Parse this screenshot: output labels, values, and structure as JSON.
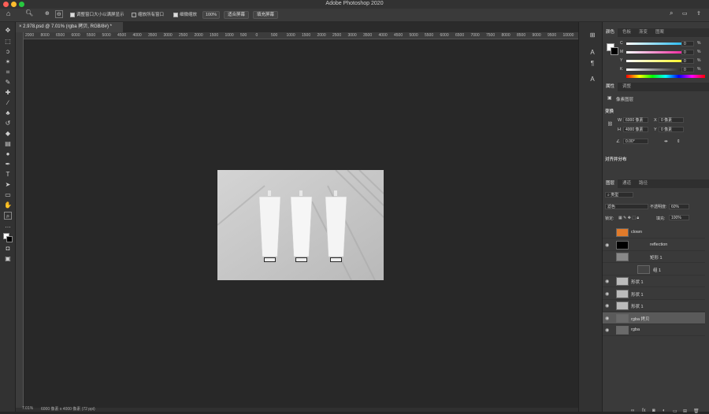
{
  "app": {
    "title": "Adobe Photoshop 2020"
  },
  "options_bar": {
    "checkbox_resize_window": "调整窗口大小以满屏显示",
    "checkbox_zoom_all": "缩放所有窗口",
    "checkbox_scrubby_zoom": "细微缩放",
    "zoom_value": "100%",
    "fit_screen": "适合屏幕",
    "fill_screen": "填充屏幕"
  },
  "document_tab": {
    "label": "2.978.psd @ 7.01% (rgba 拷贝, RGB/8#) *"
  },
  "ruler": {
    "ticks": [
      "2000",
      "8000",
      "6500",
      "6000",
      "5500",
      "5000",
      "4500",
      "4000",
      "3500",
      "3000",
      "2500",
      "2000",
      "1500",
      "1000",
      "500",
      "0",
      "500",
      "1000",
      "1500",
      "2000",
      "2500",
      "3000",
      "3500",
      "4000",
      "4500",
      "5000",
      "5500",
      "6000",
      "6500",
      "7000",
      "7500",
      "8000",
      "8500",
      "9000",
      "9500",
      "10000"
    ]
  },
  "status_bar": {
    "zoom": "7.01%",
    "info": "6000 像素 x 4000 像素 (72 ppi)"
  },
  "color_panel": {
    "tabs": [
      "颜色",
      "色板",
      "渐变",
      "图案"
    ],
    "channels": [
      {
        "label": "C",
        "value": "0",
        "unit": "%",
        "color": "#00aeef"
      },
      {
        "label": "M",
        "value": "0",
        "unit": "%",
        "color": "#ec008c"
      },
      {
        "label": "Y",
        "value": "0",
        "unit": "%",
        "color": "#fff200"
      },
      {
        "label": "K",
        "value": "0",
        "unit": "%",
        "color": "#000000"
      }
    ]
  },
  "properties_panel": {
    "tabs": [
      "属性",
      "调整"
    ],
    "type_label": "像素图层",
    "transform_title": "变换",
    "w_label": "W",
    "w_value": "6000 像素",
    "x_label": "X",
    "x_value": "0 像素",
    "h_label": "H",
    "h_value": "4000 像素",
    "y_label": "Y",
    "y_value": "0 像素",
    "angle_value": "0.00°",
    "align_title": "对齐并分布"
  },
  "layers_panel": {
    "tabs": [
      "图层",
      "通道",
      "路径"
    ],
    "filter_label": "类型",
    "blend_mode": "滤色",
    "opacity_label": "不透明度:",
    "opacity_value": "60%",
    "lock_label": "锁定:",
    "fill_label": "填充:",
    "fill_value": "100%",
    "layers": [
      {
        "name": "clown",
        "visible": false,
        "selected": false,
        "thumb": "#e07a2a"
      },
      {
        "name": "reflection",
        "visible": true,
        "selected": false,
        "thumb": "#000000"
      },
      {
        "name": "矩形 1",
        "visible": false,
        "selected": false,
        "thumb": "#888888"
      },
      {
        "name": "组 1",
        "visible": false,
        "selected": false,
        "thumb": "#444444"
      },
      {
        "name": "形状 1",
        "visible": true,
        "selected": false,
        "thumb": "#bbbbbb"
      },
      {
        "name": "形状 1",
        "visible": true,
        "selected": false,
        "thumb": "#bbbbbb"
      },
      {
        "name": "形状 1",
        "visible": true,
        "selected": false,
        "thumb": "#bbbbbb"
      },
      {
        "name": "rgba 拷贝",
        "visible": true,
        "selected": true,
        "thumb": "#6a6a6a"
      },
      {
        "name": "rgba",
        "visible": true,
        "selected": false,
        "thumb": "#6a6a6a"
      }
    ]
  }
}
